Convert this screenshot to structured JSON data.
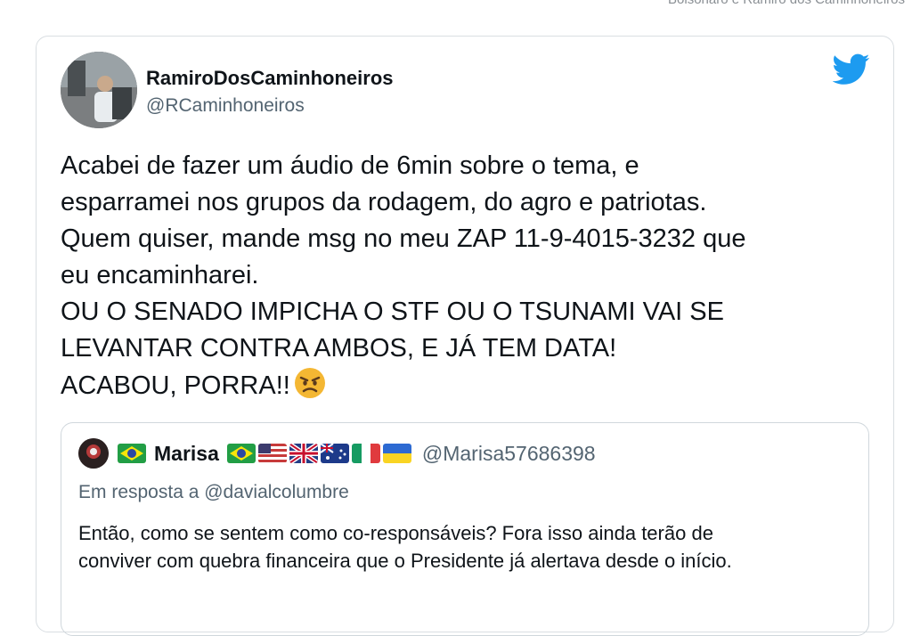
{
  "top_strip": {
    "text": "Bolsonaro e Ramiro dos Caminhoneiros"
  },
  "tweet": {
    "author_name": "RamiroDosCaminhoneiros",
    "author_handle": "@RCaminhoneiros",
    "lines": [
      "Acabei de fazer um áudio de 6min sobre o tema, e",
      "esparramei nos grupos da rodagem, do agro e patriotas.",
      "Quem quiser, mande msg no meu ZAP 11-9-4015-3232 que",
      "eu encaminharei.",
      "OU O SENADO IMPICHA O STF OU O TSUNAMI VAI SE",
      "LEVANTAR CONTRA AMBOS, E JÁ TEM DATA!",
      "ACABOU, PORRA!!"
    ],
    "icons": {
      "logo": "twitter-bird-icon",
      "emoji": "angry-face-icon"
    },
    "colors": {
      "twitter_blue": "#1d9bf0",
      "text": "#0f1419",
      "secondary": "#536471"
    }
  },
  "quoted_tweet": {
    "name": "Marisa",
    "handle": "@Marisa57686398",
    "reply_to": "Em resposta a @davialcolumbre",
    "lines": [
      "Então, como se sentem como co-responsáveis? Fora isso ainda terão de",
      "conviver com quebra financeira que o Presidente já alertava desde o início."
    ],
    "flags": [
      "brazil-flag-icon",
      "brazil-flag-icon",
      "usa-flag-icon",
      "uk-flag-icon",
      "australia-flag-icon",
      "italy-flag-icon",
      "ukraine-flag-icon"
    ]
  }
}
